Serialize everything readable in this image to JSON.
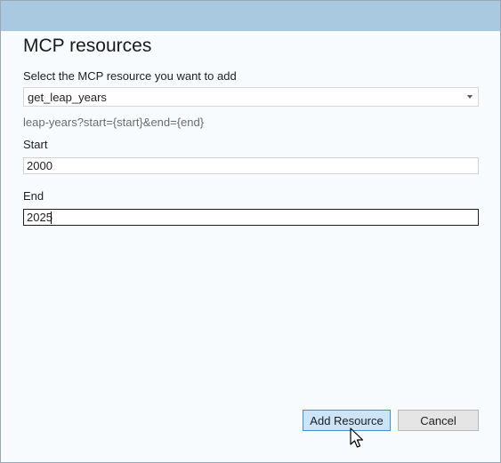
{
  "dialog": {
    "title": "MCP resources",
    "select_label": "Select the MCP resource you want to add",
    "selected_resource": "get_leap_years",
    "uri_template": "leap-years?start={start}&end={end}",
    "fields": [
      {
        "label": "Start",
        "value": "2000"
      },
      {
        "label": "End",
        "value": "2025"
      }
    ],
    "buttons": {
      "add": "Add Resource",
      "cancel": "Cancel"
    }
  },
  "colors": {
    "titlebar": "#a9c9e0",
    "primary_button_bg": "#cce4f7",
    "primary_button_border": "#3f8fd8",
    "secondary_button_bg": "#e5e5e5"
  },
  "icons": {
    "dropdown": "chevron-down-icon",
    "pointer": "mouse-cursor-icon"
  }
}
